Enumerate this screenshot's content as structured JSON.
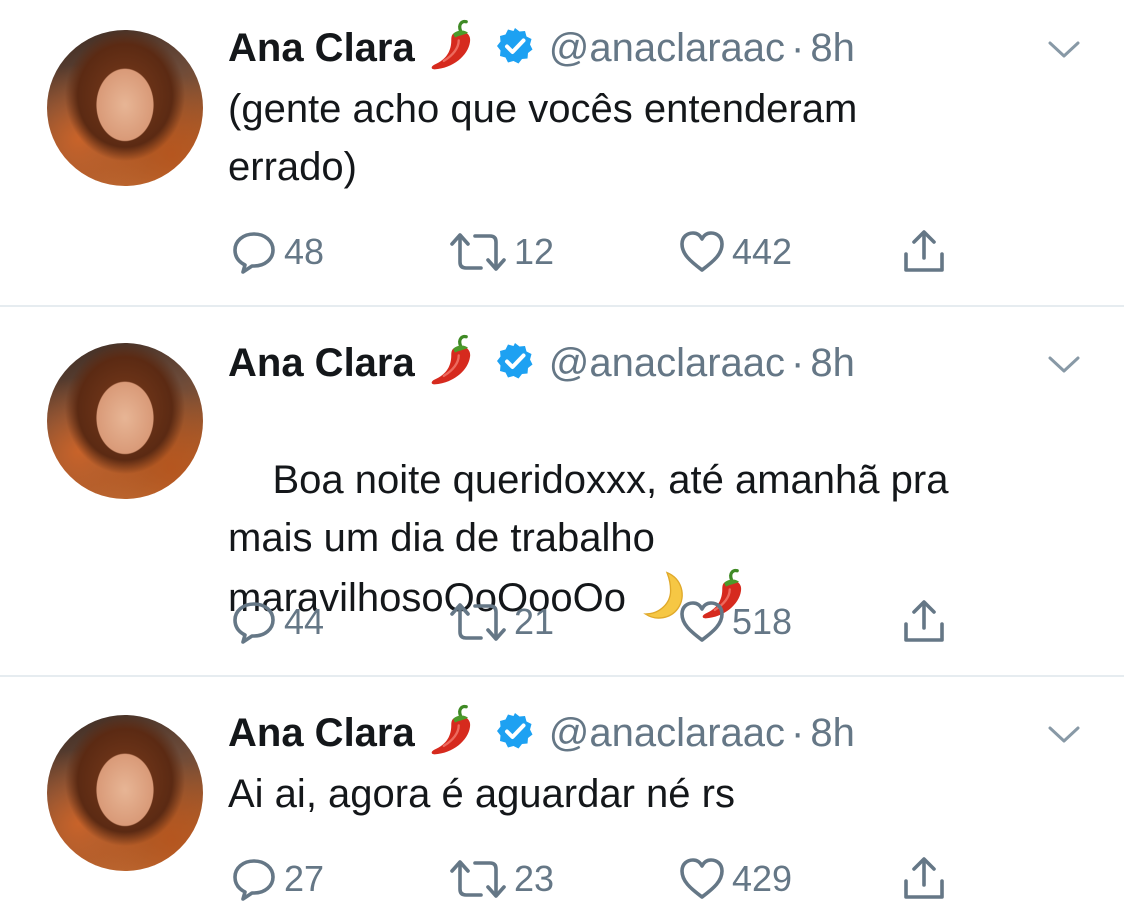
{
  "tweets": [
    {
      "name": "Ana Clara",
      "handle": "@anaclaraac",
      "separator": "·",
      "time": "8h",
      "text": "(gente acho que vocês entenderam\nerrado)",
      "replies": "48",
      "retweets": "12",
      "likes": "442"
    },
    {
      "name": "Ana Clara",
      "handle": "@anaclaraac",
      "separator": "·",
      "time": "8h",
      "text": "Boa noite queridoxxx, até amanhã pra\nmais um dia de trabalho\nmaravilhosoOoOooOo",
      "replies": "44",
      "retweets": "21",
      "likes": "518"
    },
    {
      "name": "Ana Clara",
      "handle": "@anaclaraac",
      "separator": "·",
      "time": "8h",
      "text": "Ai ai, agora é aguardar né rs",
      "replies": "27",
      "retweets": "23",
      "likes": "429"
    }
  ],
  "icons": {
    "name_emoji": "chili-pepper-icon",
    "verified": "verified-badge-icon",
    "menu": "chevron-down-icon",
    "reply": "reply-icon",
    "retweet": "retweet-icon",
    "like": "heart-icon",
    "share": "share-icon",
    "text_emojis": [
      "crescent-moon-icon",
      "chili-pepper-icon"
    ]
  },
  "colors": {
    "text": "#14171a",
    "secondary": "#657786",
    "verified": "#1da1f2",
    "pepper": "#d62a1e",
    "divider": "#e6ecf0"
  }
}
